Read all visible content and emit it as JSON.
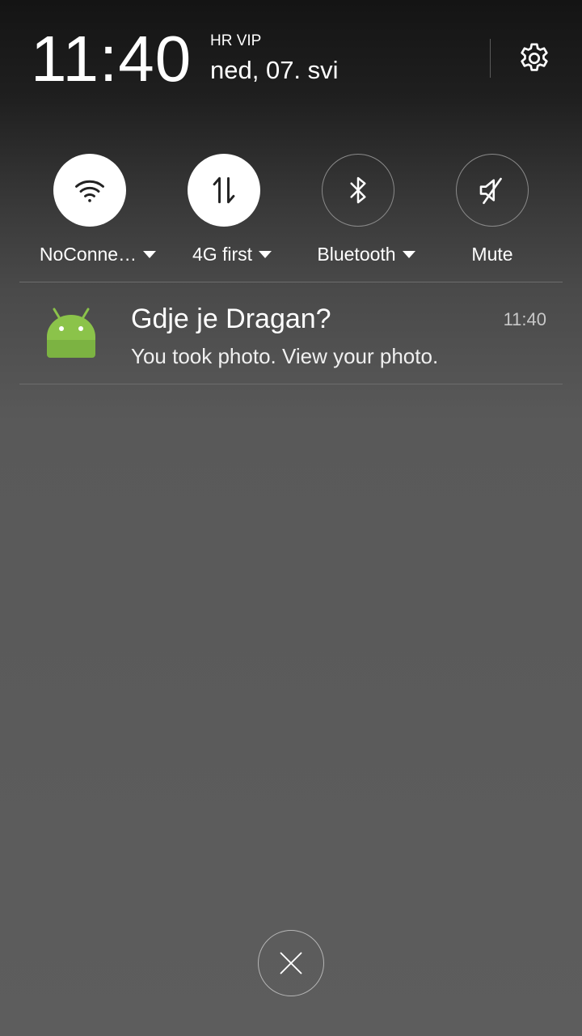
{
  "header": {
    "time": "11:40",
    "carrier": "HR VIP",
    "date": "ned, 07. svi",
    "settings_icon": "gear-icon"
  },
  "quick_settings": [
    {
      "label": "NoConne…",
      "icon": "wifi-icon",
      "state": "on",
      "has_dropdown": true
    },
    {
      "label": "4G first",
      "icon": "mobile-data-icon",
      "state": "on",
      "has_dropdown": true
    },
    {
      "label": "Bluetooth",
      "icon": "bluetooth-icon",
      "state": "off",
      "has_dropdown": true
    },
    {
      "label": "Mute",
      "icon": "mute-icon",
      "state": "off",
      "has_dropdown": false
    }
  ],
  "notification": {
    "app_icon": "android-icon",
    "title": "Gdje je Dragan?",
    "text": "You took photo. View your photo.",
    "time": "11:40"
  },
  "clear_all_icon": "close-icon",
  "colors": {
    "android_green": "#8bc34a",
    "toggle_on_bg": "#ffffff",
    "toggle_icon": "#222222"
  }
}
